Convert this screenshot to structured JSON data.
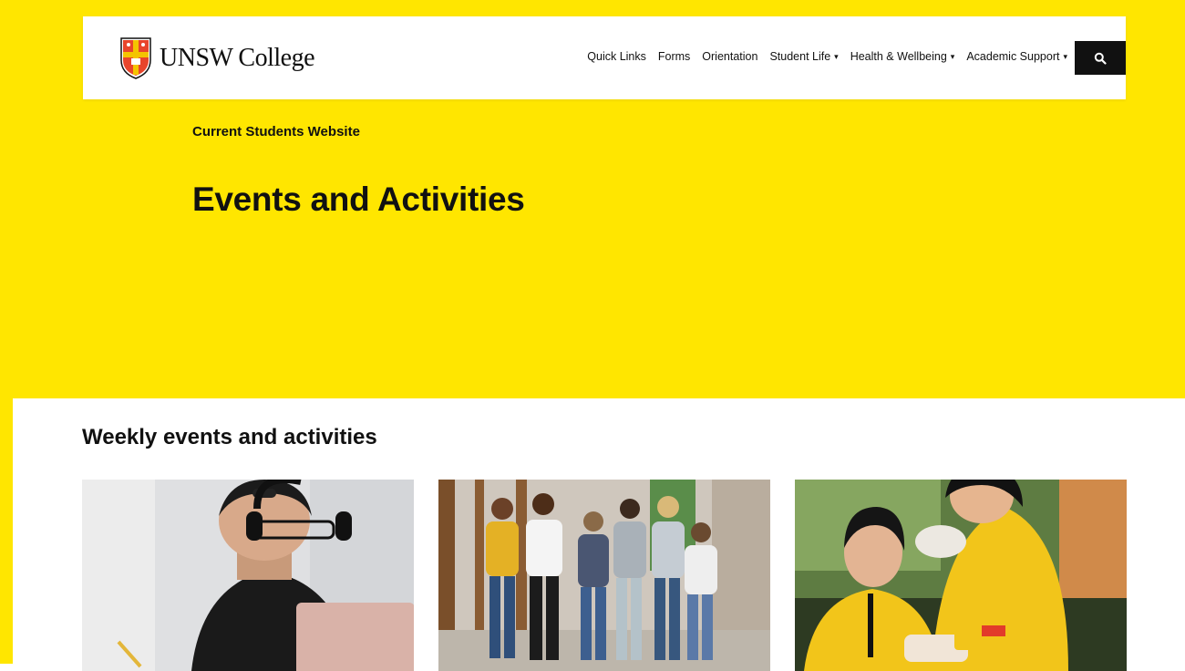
{
  "header": {
    "logo_text": "UNSW College",
    "nav": [
      {
        "label": "Quick Links"
      },
      {
        "label": "Forms"
      },
      {
        "label": "Orientation"
      },
      {
        "label": "Student Life",
        "caret": "▾"
      },
      {
        "label": "Health & Wellbeing",
        "caret": "▾"
      },
      {
        "label": "Academic Support",
        "caret": "▾"
      }
    ],
    "search_icon": "search-icon"
  },
  "hero": {
    "eyebrow": "Current Students Website",
    "title": "Events and Activities"
  },
  "section": {
    "title": "Weekly events and activities",
    "cards": [
      {
        "image": "student-with-headphones-laptop"
      },
      {
        "image": "group-of-students-walking"
      },
      {
        "image": "students-in-yellow-shirts-volunteering"
      }
    ]
  },
  "colors": {
    "brand_yellow": "#ffe600",
    "dark": "#111111"
  }
}
